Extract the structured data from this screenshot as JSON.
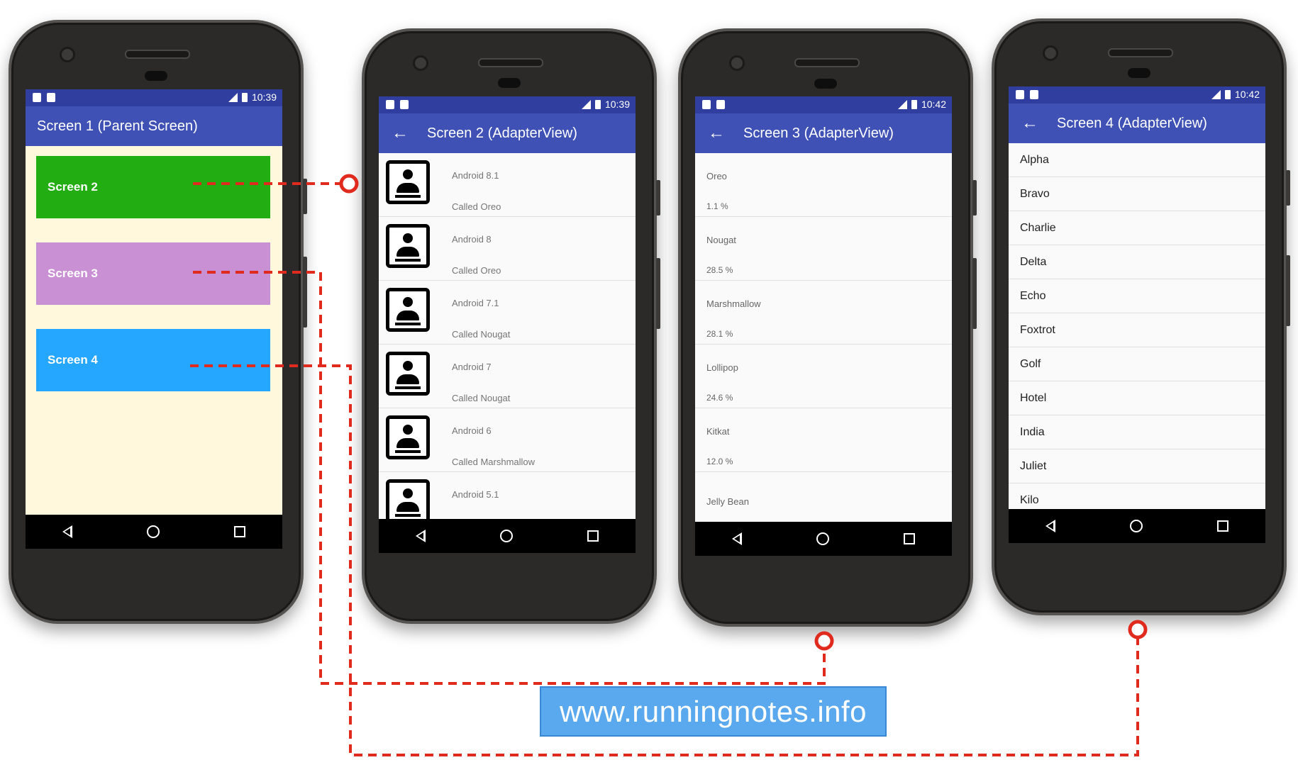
{
  "phones": {
    "screen1": {
      "status_time": "10:39",
      "title": "Screen 1 (Parent Screen)",
      "buttons": [
        {
          "label": "Screen 2",
          "color": "#22ad12"
        },
        {
          "label": "Screen 3",
          "color": "#c990d4"
        },
        {
          "label": "Screen 4",
          "color": "#26a7ff"
        }
      ],
      "background": "#fff8dc"
    },
    "screen2": {
      "status_time": "10:39",
      "title": "Screen 2 (AdapterView)",
      "items": [
        {
          "title": "Android 8.1",
          "subtitle": "Called Oreo"
        },
        {
          "title": "Android 8",
          "subtitle": "Called Oreo"
        },
        {
          "title": "Android 7.1",
          "subtitle": "Called Nougat"
        },
        {
          "title": "Android 7",
          "subtitle": "Called Nougat"
        },
        {
          "title": "Android 6",
          "subtitle": "Called Marshmallow"
        },
        {
          "title": "Android 5.1",
          "subtitle": ""
        }
      ]
    },
    "screen3": {
      "status_time": "10:42",
      "title": "Screen 3 (AdapterView)",
      "items": [
        {
          "name": "Oreo",
          "share": "1.1 %"
        },
        {
          "name": "Nougat",
          "share": "28.5 %"
        },
        {
          "name": "Marshmallow",
          "share": "28.1 %"
        },
        {
          "name": "Lollipop",
          "share": "24.6 %"
        },
        {
          "name": "Kitkat",
          "share": "12.0 %"
        },
        {
          "name": "Jelly Bean",
          "share": ""
        }
      ]
    },
    "screen4": {
      "status_time": "10:42",
      "title": "Screen 4 (AdapterView)",
      "items": [
        "Alpha",
        "Bravo",
        "Charlie",
        "Delta",
        "Echo",
        "Foxtrot",
        "Golf",
        "Hotel",
        "India",
        "Juliet",
        "Kilo"
      ]
    }
  },
  "theme": {
    "status_bar": "#303f9f",
    "app_bar": "#3f51b5",
    "connector": "#e02a1d"
  },
  "watermark": "www.runningnotes.info",
  "icons": {
    "back": "arrow-left",
    "nav_back": "triangle-back",
    "nav_home": "circle-home",
    "nav_recent": "square-recent",
    "list_item": "contact-card"
  }
}
